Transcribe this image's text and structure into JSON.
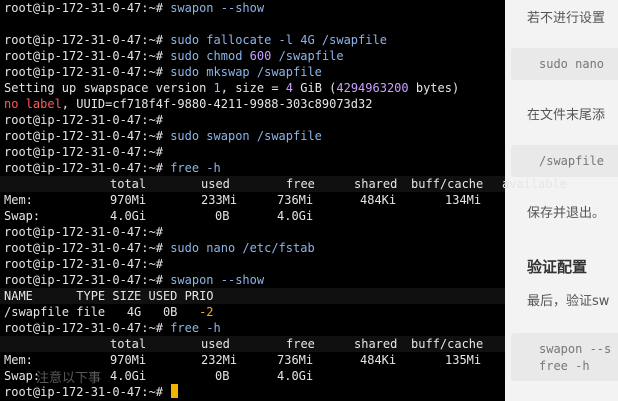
{
  "prompt": "root@ip-172-31-0-47:~#",
  "cursor_color": "#f3b400",
  "terminal": {
    "cmd1": "swapon --show",
    "cmd2": "sudo fallocate -l 4G /swapfile",
    "cmd3a": "sudo chmod ",
    "cmd3b": "600",
    "cmd3c": " /swapfile",
    "cmd4": "sudo mkswap /swapfile",
    "mk_a": "Setting up swapspace version ",
    "mk_b": "1",
    "mk_c": ", size = ",
    "mk_d": "4",
    "mk_e": " GiB (",
    "mk_f": "4294963200",
    "mk_g": " bytes)",
    "label_a": "no label",
    "label_b": ", UUID=cf718f4f-9880-4211-9988-303c89073d32",
    "cmd5": "sudo swapon /swapfile",
    "cmd6": "free -h",
    "free1": {
      "headers": [
        "total",
        "used",
        "free",
        "shared",
        "buff/cache",
        "available"
      ],
      "mem": [
        "Mem:",
        "970Mi",
        "233Mi",
        "736Mi",
        "484Ki",
        "134Mi",
        "736Mi"
      ],
      "swap": [
        "Swap:",
        "4.0Gi",
        "0B",
        "4.0Gi"
      ]
    },
    "cmd7": "sudo nano /etc/fstab",
    "cmd8": "swapon --show",
    "show_header": "NAME      TYPE SIZE USED PRIO",
    "show_row_a": "/swapfile file   4G   0B   ",
    "show_row_b": "-2",
    "cmd9": "free -h",
    "free2": {
      "headers": [
        "total",
        "used",
        "free",
        "shared",
        "buff/cache",
        "available"
      ],
      "mem": [
        "Mem:",
        "970Mi",
        "232Mi",
        "736Mi",
        "484Ki",
        "135Mi",
        "737Mi"
      ],
      "swap": [
        "Swap:",
        "4.0Gi",
        "0B",
        "4.0Gi"
      ]
    },
    "overlay_text": "注意以下事"
  },
  "doc": {
    "p1": "若不进行设置",
    "code1": "sudo nano",
    "p2": "在文件末尾添",
    "code2": "/swapfile",
    "p3": "保存并退出。",
    "h1": "验证配置",
    "p4": "最后，验证sw",
    "code3a": "swapon --s",
    "code3b": "free -h"
  }
}
